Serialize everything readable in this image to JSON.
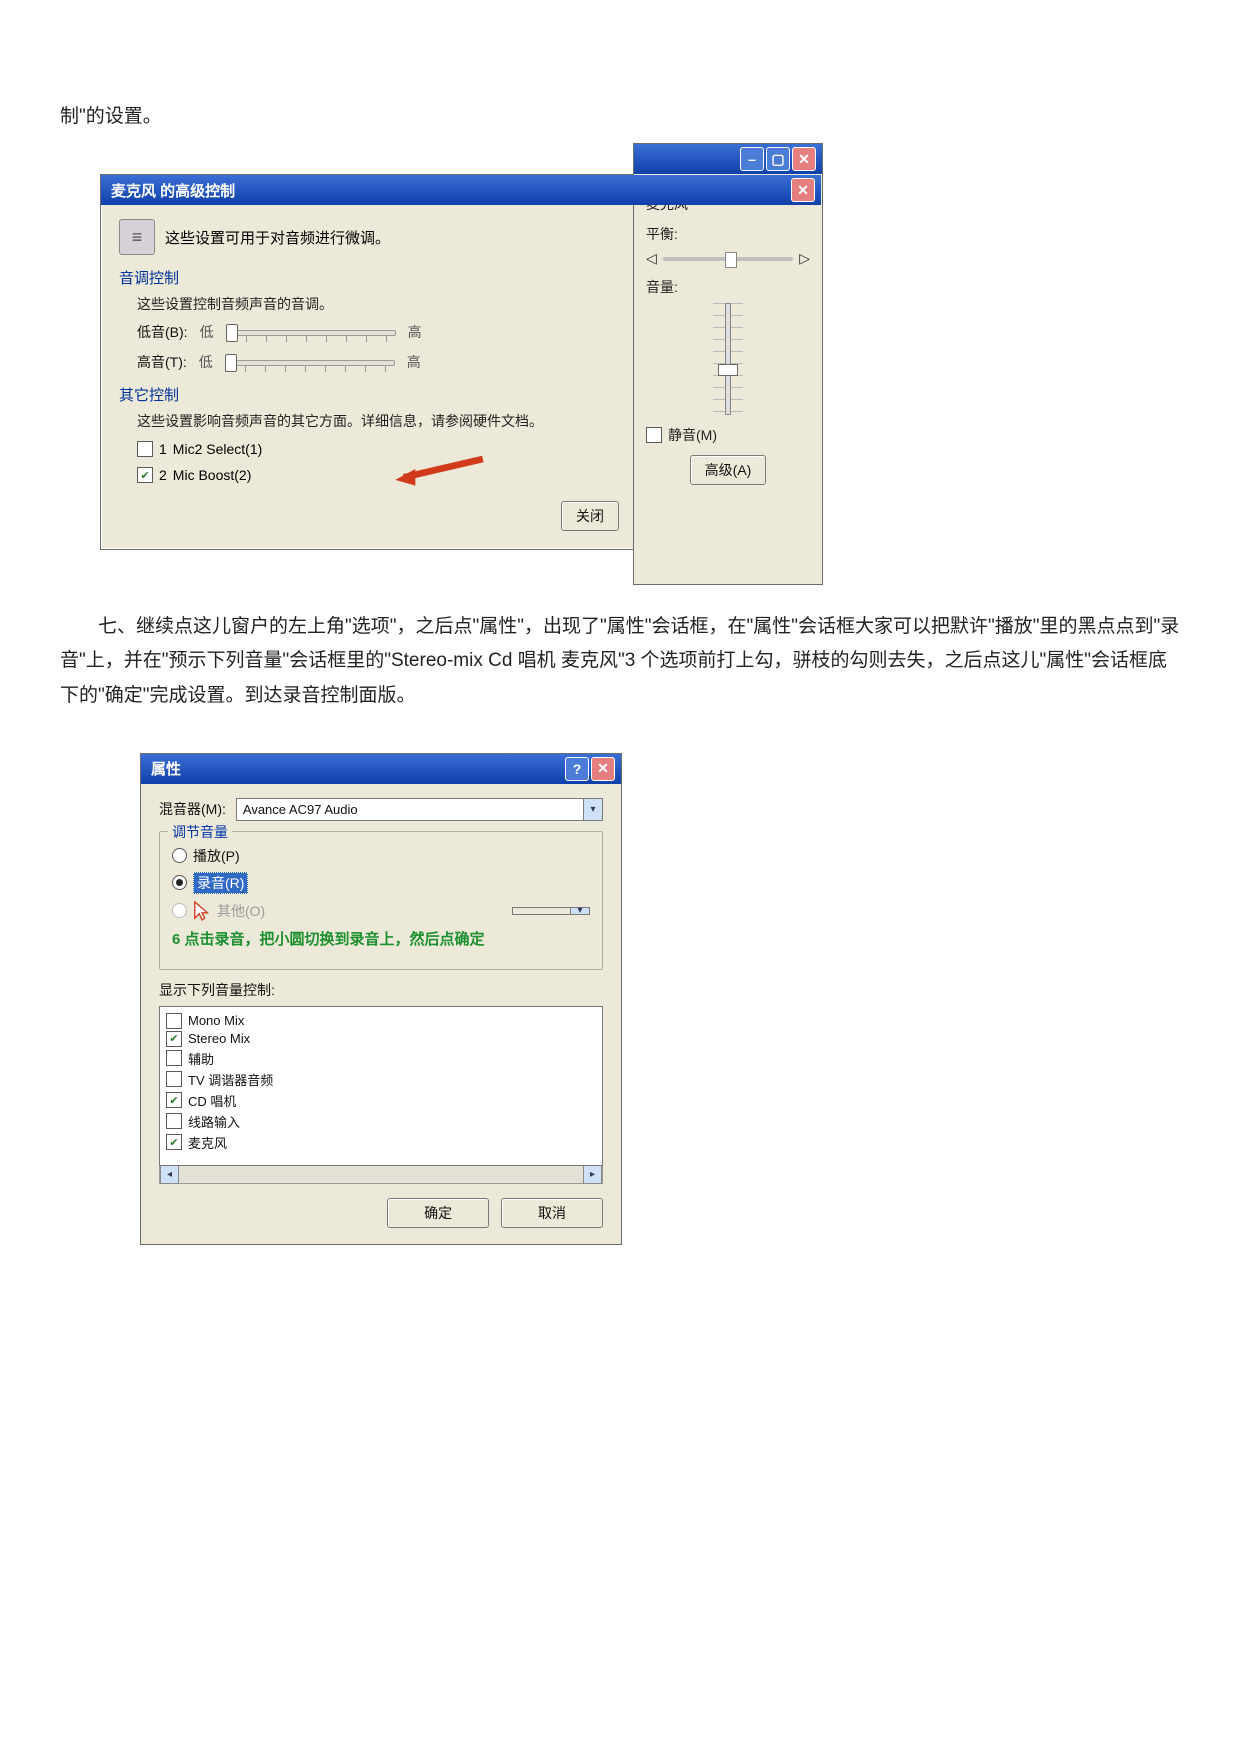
{
  "doc": {
    "frag_top": "制\"的设置。",
    "para7": "七、继续点这儿窗户的左上角\"选项\"，之后点\"属性\"，出现了\"属性\"会话框，在\"属性\"会话框大家可以把默许\"播放\"里的黑点点到\"录音\"上，并在\"预示下列音量\"会话框里的\"Stereo-mix Cd 唱机 麦克风\"3 个选项前打上勾，骈枝的勾则去失，之后点这儿\"属性\"会话框底下的\"确定\"完成设置。到达录音控制面版。"
  },
  "dlg1": {
    "title": "麦克风 的高级控制",
    "intro": "这些设置可用于对音频进行微调。",
    "tone": {
      "heading": "音调控制",
      "desc": "这些设置控制音频声音的音调。",
      "bass_label": "低音(B):",
      "treble_label": "高音(T):",
      "low": "低",
      "high": "高"
    },
    "other": {
      "heading": "其它控制",
      "desc": "这些设置影响音频声音的其它方面。详细信息，请参阅硬件文档。",
      "opt1_num": "1",
      "opt1": "Mic2 Select(1)",
      "opt2_num": "2",
      "opt2": "Mic Boost(2)"
    },
    "close": "关闭"
  },
  "micpanel": {
    "title": "麦克风",
    "balance": "平衡:",
    "volume": "音量:",
    "mute": "静音(M)",
    "advanced": "高级(A)"
  },
  "dlg2": {
    "title": "属性",
    "mixer_label": "混音器(M):",
    "mixer_value": "Avance AC97 Audio",
    "group_adjust": "调节音量",
    "playback": "播放(P)",
    "record": "录音(R)",
    "other": "其他(O)",
    "note": "6 点击录音，把小圆切换到录音上，然后点确定",
    "show_group": "显示下列音量控制:",
    "list": [
      {
        "label": "Mono Mix",
        "checked": false
      },
      {
        "label": "Stereo Mix",
        "checked": true
      },
      {
        "label": "辅助",
        "checked": false
      },
      {
        "label": "TV 调谐器音频",
        "checked": false
      },
      {
        "label": "CD 唱机",
        "checked": true
      },
      {
        "label": "线路输入",
        "checked": false
      },
      {
        "label": "麦克风",
        "checked": true
      }
    ],
    "ok": "确定",
    "cancel": "取消"
  }
}
